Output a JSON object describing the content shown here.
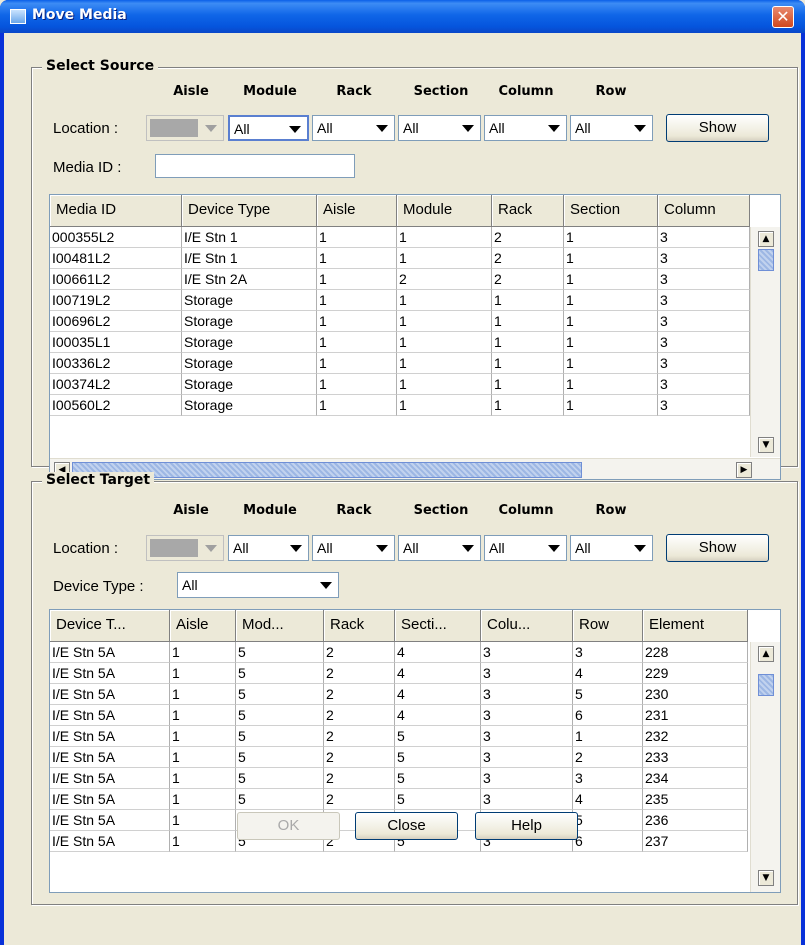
{
  "window": {
    "title": "Move Media",
    "close_glyph": "✕"
  },
  "location_columns": [
    "Aisle",
    "Module",
    "Rack",
    "Section",
    "Column",
    "Row"
  ],
  "source": {
    "group_title": "Select Source",
    "location_label": "Location :",
    "aisle_value": "",
    "module_value": "All",
    "rack_value": "All",
    "section_value": "All",
    "column_value": "All",
    "row_value": "All",
    "show_label": "Show",
    "media_id_label": "Media ID :",
    "media_id_value": "",
    "table": {
      "columns": [
        "Media ID",
        "Device Type",
        "Aisle",
        "Module",
        "Rack",
        "Section",
        "Column"
      ],
      "rows": [
        [
          "000355L2",
          "I/E Stn 1",
          "1",
          "1",
          "2",
          "1",
          "3"
        ],
        [
          "I00481L2",
          "I/E Stn 1",
          "1",
          "1",
          "2",
          "1",
          "3"
        ],
        [
          "I00661L2",
          "I/E Stn 2A",
          "1",
          "2",
          "2",
          "1",
          "3"
        ],
        [
          "I00719L2",
          "Storage",
          "1",
          "1",
          "1",
          "1",
          "3"
        ],
        [
          "I00696L2",
          "Storage",
          "1",
          "1",
          "1",
          "1",
          "3"
        ],
        [
          "I00035L1",
          "Storage",
          "1",
          "1",
          "1",
          "1",
          "3"
        ],
        [
          "I00336L2",
          "Storage",
          "1",
          "1",
          "1",
          "1",
          "3"
        ],
        [
          "I00374L2",
          "Storage",
          "1",
          "1",
          "1",
          "1",
          "3"
        ],
        [
          "I00560L2",
          "Storage",
          "1",
          "1",
          "1",
          "1",
          "3"
        ]
      ]
    }
  },
  "target": {
    "group_title": "Select Target",
    "location_label": "Location :",
    "aisle_value": "",
    "module_value": "All",
    "rack_value": "All",
    "section_value": "All",
    "column_value": "All",
    "row_value": "All",
    "show_label": "Show",
    "device_type_label": "Device Type :",
    "device_type_value": "All",
    "table": {
      "columns": [
        "Device T...",
        "Aisle",
        "Mod...",
        "Rack",
        "Secti...",
        "Colu...",
        "Row",
        "Element"
      ],
      "rows": [
        [
          "I/E Stn 5A",
          "1",
          "5",
          "2",
          "4",
          "3",
          "3",
          "228"
        ],
        [
          "I/E Stn 5A",
          "1",
          "5",
          "2",
          "4",
          "3",
          "4",
          "229"
        ],
        [
          "I/E Stn 5A",
          "1",
          "5",
          "2",
          "4",
          "3",
          "5",
          "230"
        ],
        [
          "I/E Stn 5A",
          "1",
          "5",
          "2",
          "4",
          "3",
          "6",
          "231"
        ],
        [
          "I/E Stn 5A",
          "1",
          "5",
          "2",
          "5",
          "3",
          "1",
          "232"
        ],
        [
          "I/E Stn 5A",
          "1",
          "5",
          "2",
          "5",
          "3",
          "2",
          "233"
        ],
        [
          "I/E Stn 5A",
          "1",
          "5",
          "2",
          "5",
          "3",
          "3",
          "234"
        ],
        [
          "I/E Stn 5A",
          "1",
          "5",
          "2",
          "5",
          "3",
          "4",
          "235"
        ],
        [
          "I/E Stn 5A",
          "1",
          "5",
          "2",
          "5",
          "3",
          "5",
          "236"
        ],
        [
          "I/E Stn 5A",
          "1",
          "5",
          "2",
          "5",
          "3",
          "6",
          "237"
        ]
      ]
    }
  },
  "footer": {
    "ok_label": "OK",
    "close_label": "Close",
    "help_label": "Help"
  },
  "icons": {
    "window_icon": "app-window-icon",
    "close": "close-icon",
    "dropdown": "chevron-down-icon",
    "scroll_up": "arrow-up-icon",
    "scroll_down": "arrow-down-icon",
    "scroll_left": "arrow-left-icon",
    "scroll_right": "arrow-right-icon"
  },
  "colors": {
    "titlebar": "#0a5fe8",
    "close_button": "#d1481e",
    "dialog_bg": "#ece9d8"
  }
}
